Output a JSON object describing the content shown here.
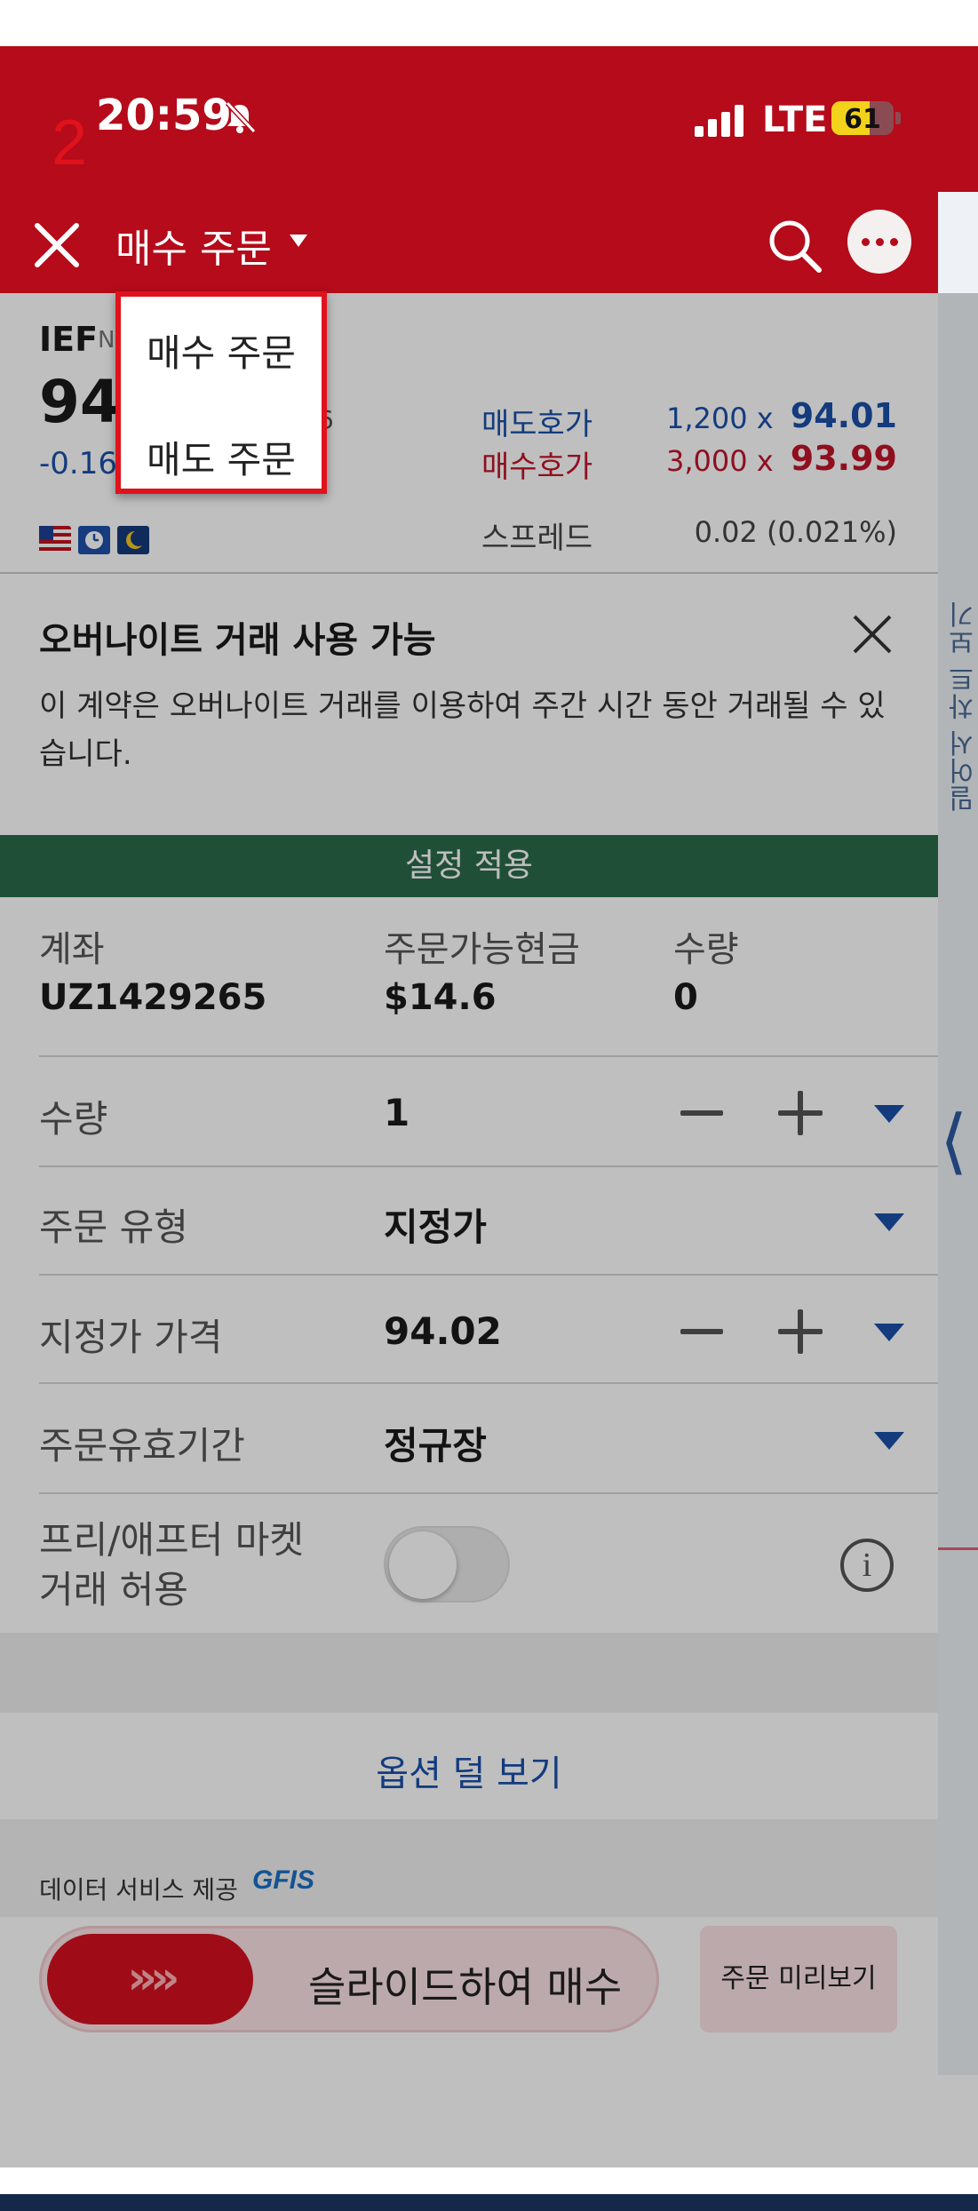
{
  "status_bar": {
    "time": "20:59",
    "network": "LTE",
    "battery": "61",
    "battery_level": 0.61,
    "step_label": "2"
  },
  "header": {
    "title": "매수 주문",
    "icons": [
      "close-icon",
      "caret-down-icon",
      "search-icon",
      "more-icon"
    ]
  },
  "order_menu": {
    "items": [
      "매수 주문",
      "매도 주문"
    ]
  },
  "quote": {
    "symbol": "IEF",
    "exchange": "N",
    "price": "94.",
    "change": "-0.16",
    "volume_fragment": "06",
    "ask_label": "매도호가",
    "ask_size": "1,200 x",
    "ask_price": "94.01",
    "bid_label": "매수호가",
    "bid_size": "3,000 x",
    "bid_price": "93.99",
    "spread_label": "스프레드",
    "spread_value": "0.02 (0.021%)"
  },
  "notice": {
    "title": "오버나이트 거래 사용 가능",
    "body": "이 계약은 오버나이트 거래를 이용하여 주간 시간 동안 거래될 수 있습니다."
  },
  "apply_settings": "설정 적용",
  "account": {
    "account_label": "계좌",
    "account_value": "UZ1429265",
    "cash_label": "주문가능현금",
    "cash_value": "$14.6",
    "qty_label": "수량",
    "qty_value": "0"
  },
  "form": {
    "quantity_label": "수량",
    "quantity_value": "1",
    "order_type_label": "주문 유형",
    "order_type_value": "지정가",
    "limit_price_label": "지정가 가격",
    "limit_price_value": "94.02",
    "tif_label": "주문유효기간",
    "tif_value": "정규장",
    "extended_label_1": "프리/애프터 마켓",
    "extended_label_2": "거래 허용"
  },
  "options_link": "옵션 덜 보기",
  "data_provider_label": "데이터 서비스 제공",
  "data_provider_brand": "GFIS",
  "slider": {
    "thumb": "»»",
    "label": "슬라이드하여 매수"
  },
  "preview_button": "주문 미리보기",
  "side_panel": {
    "label": "밀어서 차트 보기",
    "chevron": "⟨"
  },
  "colors": {
    "header_red": "#b50b1a",
    "ask_blue": "#1a4fa8",
    "bid_red": "#c0142a",
    "apply_green": "#2b6a4b"
  }
}
